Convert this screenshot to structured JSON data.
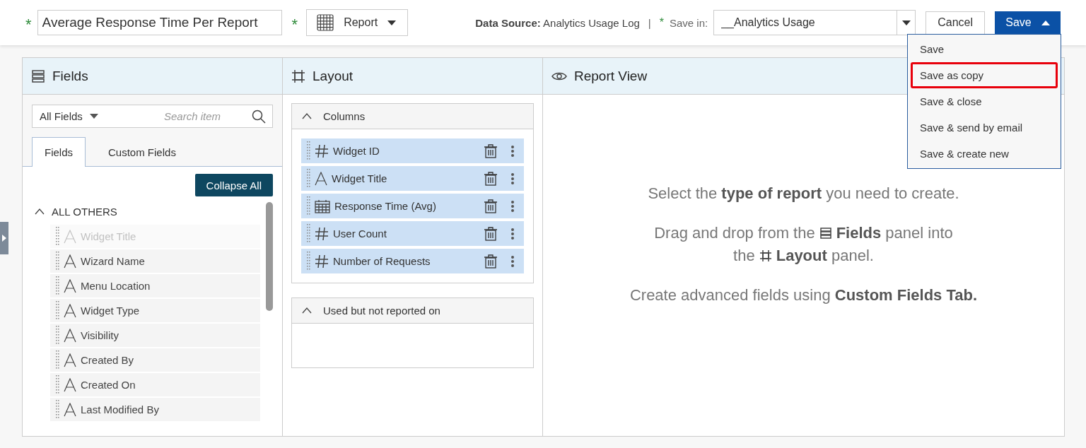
{
  "header": {
    "title_value": "Average Response Time Per Report",
    "type_select": "Report",
    "data_source_label": "Data Source:",
    "data_source_value": "Analytics Usage Log",
    "separator": "|",
    "save_in_label": "Save in:",
    "save_in_value": "__Analytics Usage",
    "required_mark": "*",
    "cancel": "Cancel",
    "save": "Save"
  },
  "save_menu": {
    "open": true,
    "items": [
      {
        "label": "Save",
        "selected": false
      },
      {
        "label": "Save as copy",
        "selected": true
      },
      {
        "label": "Save & close",
        "selected": false
      },
      {
        "label": "Save & send by email",
        "selected": false
      },
      {
        "label": "Save & create new",
        "selected": false
      }
    ]
  },
  "fields_panel": {
    "title": "Fields",
    "filter": "All Fields",
    "search_placeholder": "Search item",
    "tabs": [
      {
        "label": "Fields",
        "selected": true
      },
      {
        "label": "Custom Fields",
        "selected": false
      }
    ],
    "collapse_all": "Collapse All",
    "group": {
      "label": "ALL OTHERS",
      "expanded": true,
      "items": [
        {
          "label": "Widget Title",
          "disabled": true
        },
        {
          "label": "Wizard Name",
          "disabled": false
        },
        {
          "label": "Menu Location",
          "disabled": false
        },
        {
          "label": "Widget Type",
          "disabled": false
        },
        {
          "label": "Visibility",
          "disabled": false
        },
        {
          "label": "Created By",
          "disabled": false
        },
        {
          "label": "Created On",
          "disabled": false
        },
        {
          "label": "Last Modified By",
          "disabled": false
        }
      ]
    }
  },
  "layout_panel": {
    "title": "Layout",
    "sections": [
      {
        "label": "Columns",
        "expanded": true,
        "items": [
          {
            "label": "Widget ID",
            "kind": "number"
          },
          {
            "label": "Widget Title",
            "kind": "text"
          },
          {
            "label": "Response Time (Avg)",
            "kind": "date"
          },
          {
            "label": "User Count",
            "kind": "number"
          },
          {
            "label": "Number of Requests",
            "kind": "number"
          }
        ]
      },
      {
        "label": "Used but not reported on",
        "expanded": true
      }
    ]
  },
  "report_view": {
    "title": "Report View",
    "lines": [
      {
        "before": "Select the **type of report** you need to create.",
        "kind": "plain"
      },
      {
        "before": "Drag and drop from the",
        "kind": "fields",
        "after": "**Fields** panel into"
      },
      {
        "before": "the",
        "kind": "layout",
        "after": "**Layout** panel."
      },
      {
        "before": "Create advanced fields using **Custom Fields Tab.**",
        "kind": "plain"
      }
    ]
  }
}
